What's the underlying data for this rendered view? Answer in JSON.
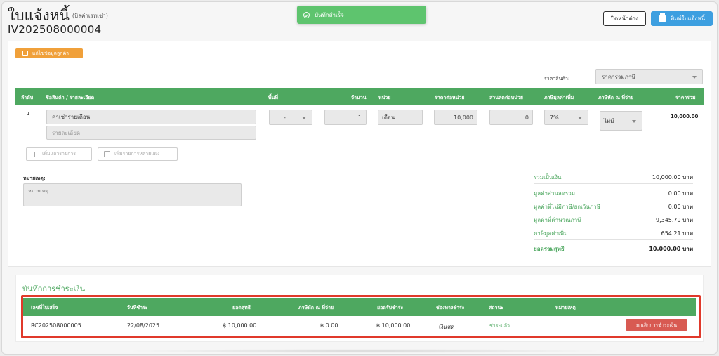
{
  "header": {
    "title": "ใบแจ้งหนี้",
    "subtitle": "(บิลค่าเรทเช่า)",
    "doc_no": "IV202508000004",
    "close_label": "ปิดหน้าต่าง",
    "print_label": "พิมพ์ใบแจ้งหนี้"
  },
  "toast": {
    "message": "บันทึกสำเร็จ"
  },
  "customer": {
    "edit_label": "แก้ไขข้อมูลลูกค้า"
  },
  "pricing": {
    "label": "ราคาสินค้า:",
    "selected": "ราคารวมภาษี"
  },
  "items_table": {
    "headers": [
      "ลำดับ",
      "ชื่อสินค้า / รายละเอียด",
      "พื้นที่",
      "จำนวน",
      "หน่วย",
      "ราคาต่อหน่วย",
      "ส่วนลดต่อหน่วย",
      "ภาษีมูลค่าเพิ่ม",
      "ภาษีหัก ณ ที่จ่าย",
      "ราคารวม"
    ],
    "rows": [
      {
        "index": "1",
        "name": "ค่าเช่ารายเดือน",
        "detail_placeholder": "รายละเอียด",
        "area": "-",
        "qty": "1",
        "unit": "เดือน",
        "unit_price": "10,000",
        "discount": "0",
        "vat": "7%",
        "wht": "ไม่มี",
        "total": "10,000.00"
      }
    ],
    "add_row_label": "เพิ่มแถวรายการ",
    "add_multi_label": "เพิ่มรายการหลายแผง"
  },
  "note": {
    "label": "หมายเหตุ:",
    "placeholder": "หมายเหตุ"
  },
  "summary": [
    {
      "label": "รวมเป็นเงิน",
      "value": "10,000.00 บาท"
    },
    {
      "label": "มูลค่าส่วนลดรวม",
      "value": "0.00 บาท"
    },
    {
      "label": "มูลค่าที่ไม่มีภาษี/ยกเว้นภาษี",
      "value": "0.00 บาท"
    },
    {
      "label": "มูลค่าที่คำนวณภาษี",
      "value": "9,345.79 บาท"
    },
    {
      "label": "ภาษีมูลค่าเพิ่ม",
      "value": "654.21 บาท"
    },
    {
      "label": "ยอดรวมสุทธิ",
      "value": "10,000.00 บาท"
    }
  ],
  "payments": {
    "title": "บันทึกการชำระเงิน",
    "headers": [
      "เลขที่ใบเสร็จ",
      "วันที่ชำระ",
      "ยอดสุทธิ",
      "ภาษีหัก ณ ที่จ่าย",
      "ยอดรับชำระ",
      "ช่องทางชำระ",
      "สถานะ",
      "หมายเหตุ"
    ],
    "rows": [
      {
        "receipt_no": "RC202508000005",
        "date": "22/08/2025",
        "net": "฿ 10,000.00",
        "wht": "฿ 0.00",
        "received": "฿ 10,000.00",
        "channel": "เงินสด",
        "status": "ชำระแล้ว",
        "cancel_label": "ยกเลิกการชำระเงิน"
      }
    ]
  },
  "colors": {
    "accent_green": "#4ea860",
    "accent_blue": "#3d9fe0",
    "accent_orange": "#f0a03a",
    "danger": "#d85a52",
    "highlight_border": "#e0392b"
  }
}
